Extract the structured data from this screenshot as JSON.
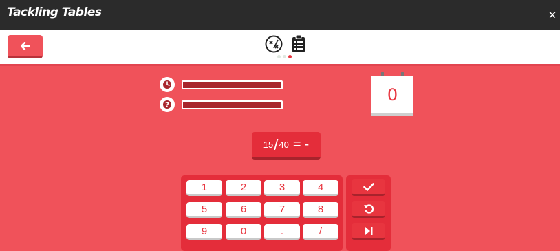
{
  "window": {
    "title": "Tackling Tables",
    "close_icon": "close-icon"
  },
  "toolbar": {
    "back_icon": "arrow-left-icon",
    "mode_icons": [
      "multiply-divide-icon",
      "clipboard-list-icon"
    ],
    "page_dots": 3,
    "active_dot": 3
  },
  "progress": {
    "timer_icon": "clock-icon",
    "questions_icon": "question-icon"
  },
  "score": {
    "value": "0"
  },
  "question": {
    "numerator": "15",
    "denominator": "40",
    "equals": "=",
    "answer": "-"
  },
  "keypad": {
    "keys": [
      "1",
      "2",
      "3",
      "4",
      "5",
      "6",
      "7",
      "8",
      "9",
      "0",
      ".",
      "/"
    ]
  },
  "actions": [
    "check-icon",
    "undo-icon",
    "skip-icon"
  ],
  "colors": {
    "accent": "#f0525a",
    "dark_accent": "#e42d3a",
    "bar": "#a8262d"
  }
}
